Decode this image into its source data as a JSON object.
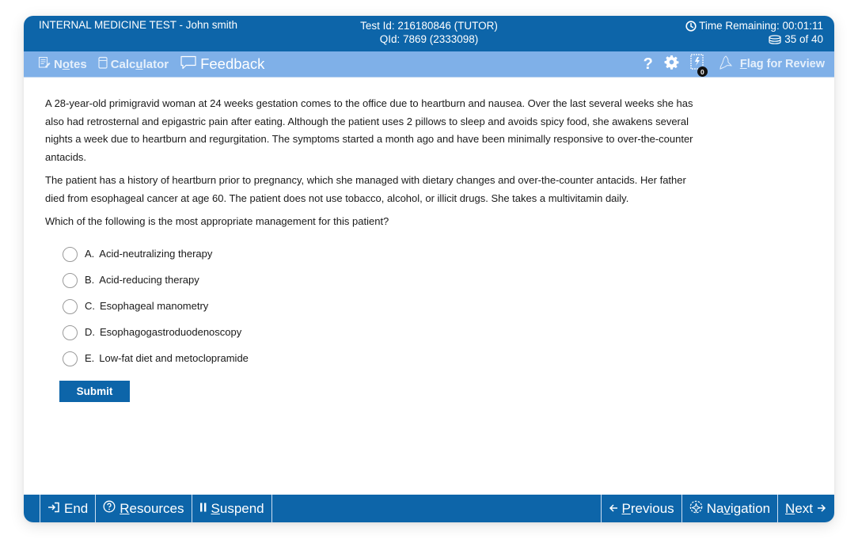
{
  "header": {
    "title": "INTERNAL MEDICINE TEST - John smith",
    "test_id": "Test Id: 216180846 (TUTOR)",
    "question_id": "QId: 7869 (2333098)",
    "time_remaining": "Time Remaining: 00:01:11",
    "progress": "35 of 40",
    "icons": {
      "clock": "clock-icon",
      "questions": "question-stack-icon"
    }
  },
  "toolbar": {
    "notes_label_pre": "N",
    "notes_label_u": "o",
    "notes_label_post": "tes",
    "calculator_label_pre": "Calc",
    "calculator_label_u": "u",
    "calculator_label_post": "lator",
    "feedback_label": "Feedback",
    "help_label": "?",
    "lab_badge_count": "0",
    "flag_label_u": "F",
    "flag_label_post": "lag for Review"
  },
  "question": {
    "stem_paragraphs": [
      "A 28-year-old primigravid woman at 24 weeks gestation comes to the office due to heartburn and nausea.  Over the last several weeks she has also had retrosternal and epigastric pain after eating.  Although the patient uses 2 pillows to sleep and avoids spicy food, she awakens several nights a week due to heartburn and regurgitation.  The symptoms started a month ago and have been minimally responsive to over-the-counter antacids.",
      "The patient has a history of heartburn prior to pregnancy, which she managed with dietary changes and over-the-counter antacids. Her father died from esophageal cancer at age 60.  The patient does not use tobacco, alcohol, or illicit drugs.  She takes a multivitamin daily."
    ],
    "prompt": "Which of the following is the most appropriate management for this patient?",
    "choices": [
      {
        "letter": "A.",
        "text": "Acid-neutralizing therapy",
        "selected": false
      },
      {
        "letter": "B.",
        "text": "Acid-reducing therapy",
        "selected": false
      },
      {
        "letter": "C.",
        "text": "Esophageal manometry",
        "selected": false
      },
      {
        "letter": "D.",
        "text": "Esophagogastroduodenoscopy",
        "selected": false
      },
      {
        "letter": "E.",
        "text": "Low-fat diet and metoclopramide",
        "selected": false
      }
    ],
    "submit_label": "Submit"
  },
  "footer": {
    "end_label": "End",
    "resources_u": "R",
    "resources_post": "esources",
    "suspend_u": "S",
    "suspend_post": "uspend",
    "previous_u": "P",
    "previous_post": "revious",
    "navigation_pre": "Na",
    "navigation_u": "v",
    "navigation_post": "igation",
    "next_u": "N",
    "next_post": "ext"
  },
  "colors": {
    "header_blue": "#0d65a9",
    "toolbar_blue": "#7fb0e8",
    "text": "#1a1a1a"
  }
}
